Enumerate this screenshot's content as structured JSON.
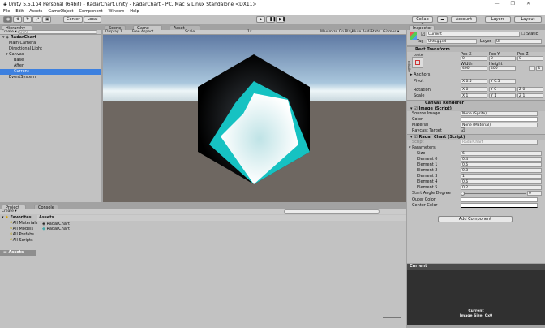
{
  "title": "Unity 5.5.1p4 Personal (64bit) - RadarChart.unity - RadarChart - PC, Mac & Linux Standalone <DX11>",
  "window_controls": [
    "—",
    "❐",
    "✕"
  ],
  "menu": [
    "File",
    "Edit",
    "Assets",
    "GameObject",
    "Component",
    "Window",
    "Help"
  ],
  "toolbar": {
    "center": "Center",
    "local": "Local",
    "collab": "Collab ▾",
    "account": "Account",
    "layers": "Layers",
    "layout": "Layout"
  },
  "hierarchy": {
    "tab": "Hierarchy",
    "create": "Create ▾",
    "search": "Q▾All",
    "scene": "RadarChart",
    "items": [
      "Main Camera",
      "Directional Light",
      "Canvas",
      "Base",
      "After",
      "Current",
      "EventSystem"
    ]
  },
  "game": {
    "tabs": [
      "Scene",
      "Game",
      "Asset Store"
    ],
    "display": "Display 1",
    "aspect": "Free Aspect",
    "scale_label": "Scale",
    "scale_value": "1x",
    "buttons": [
      "Maximize On Play",
      "Mute Audio",
      "Stats",
      "Gizmos ▾"
    ]
  },
  "colors": {
    "sky_top": "#5f7aa4",
    "sky_horizon": "#e6f2f8",
    "ground": "#6e6761",
    "outer": "#000000",
    "mid": "#16c2c2",
    "inner": "#ffffff"
  },
  "inspector": {
    "tab": "Inspector",
    "name": "Current",
    "static": "Static",
    "tag_label": "Tag",
    "tag": "Untagged",
    "layer_label": "Layer",
    "layer": "UI",
    "rect": {
      "title": "Rect Transform",
      "anchor_h": "center",
      "anchor_v": "middle",
      "posx": "Pos X",
      "posy": "Pos Y",
      "posz": "Pos Z",
      "px": "0",
      "py": "0",
      "pz": "0",
      "width_label": "Width",
      "height_label": "Height",
      "width": "400",
      "height": "400",
      "anchors": "Anchors",
      "pivot": "Pivot",
      "pivot_x": "0.5",
      "pivot_y": "0.5",
      "rotation": "Rotation",
      "rot": [
        "0",
        "0",
        "0"
      ],
      "scale": "Scale",
      "scl": [
        "1",
        "1",
        "1"
      ],
      "r_btn": "R"
    },
    "canvas_renderer": "Canvas Renderer",
    "image": {
      "title": "Image (Script)",
      "source_label": "Source Image",
      "source": "None (Sprite)",
      "color_label": "Color",
      "material_label": "Material",
      "material": "None (Material)",
      "raycast_label": "Raycast Target"
    },
    "radar": {
      "title": "Radar Chart (Script)",
      "script_label": "Script",
      "script": "RadarChart",
      "params": "Parameters",
      "size_label": "Size",
      "size": "6",
      "elements": [
        {
          "label": "Element 0",
          "value": "0.4"
        },
        {
          "label": "Element 1",
          "value": "0.6"
        },
        {
          "label": "Element 2",
          "value": "0.8"
        },
        {
          "label": "Element 3",
          "value": "1"
        },
        {
          "label": "Element 4",
          "value": "0.6"
        },
        {
          "label": "Element 5",
          "value": "0.2"
        }
      ],
      "angle_label": "Start Angle Degree",
      "angle": "0",
      "outer_label": "Outer Color",
      "center_label": "Center Color"
    },
    "add_component": "Add Component"
  },
  "preview": {
    "tab": "Current",
    "name": "Current",
    "size": "Image Size: 0x0"
  },
  "project": {
    "tabs": [
      "Project",
      "Console"
    ],
    "create": "Create ▾",
    "favorites": "Favorites",
    "fav_items": [
      "All Materials",
      "All Models",
      "All Prefabs",
      "All Scripts"
    ],
    "assets_root": "Assets",
    "assets_header": "Assets",
    "assets": [
      "RadarChart",
      "RadarChart"
    ]
  }
}
